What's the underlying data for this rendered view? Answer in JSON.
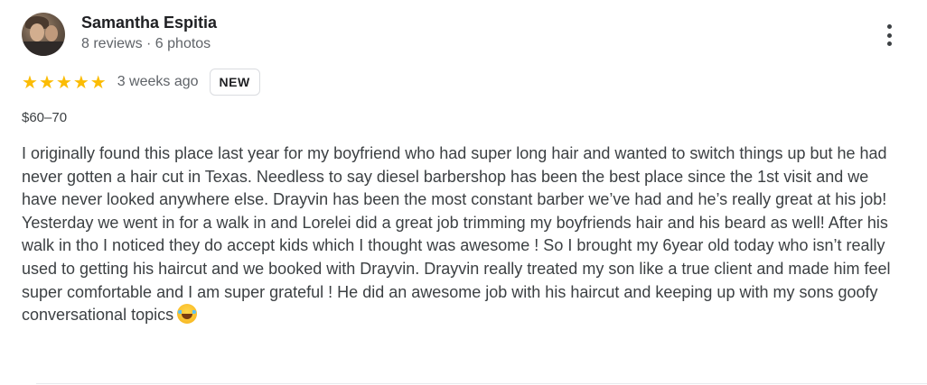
{
  "reviewer": {
    "name": "Samantha Espitia",
    "meta": "8 reviews · 6 photos"
  },
  "rating": {
    "stars": 5,
    "star_glyph": "★",
    "star_color": "#fbbc04",
    "time_ago": "3 weeks ago",
    "badge": "NEW"
  },
  "price": "$60–70",
  "review_text": "I originally found this place last year for my boyfriend who had super long hair and wanted to switch things up but he had never gotten a hair cut in Texas. Needless to say diesel barbershop has been the best place since the 1st visit and we have never looked anywhere else. Drayvin has been the most constant barber we’ve had and he’s really great at his job! Yesterday we went in for a walk in and Lorelei did a great job trimming my boyfriends hair and his beard as well! After his walk in tho I noticed they do accept kids which I thought was awesome ! So I brought my 6year old today who isn’t really used to getting his haircut and we booked with Drayvin. Drayvin really treated my son like a true client and made him feel super comfortable and I am super grateful ! He did an awesome job with his haircut and keeping up with my sons goofy conversational topics",
  "icons": {
    "more": "more-vert-icon",
    "emoji": "face-with-tears-of-joy-icon"
  }
}
